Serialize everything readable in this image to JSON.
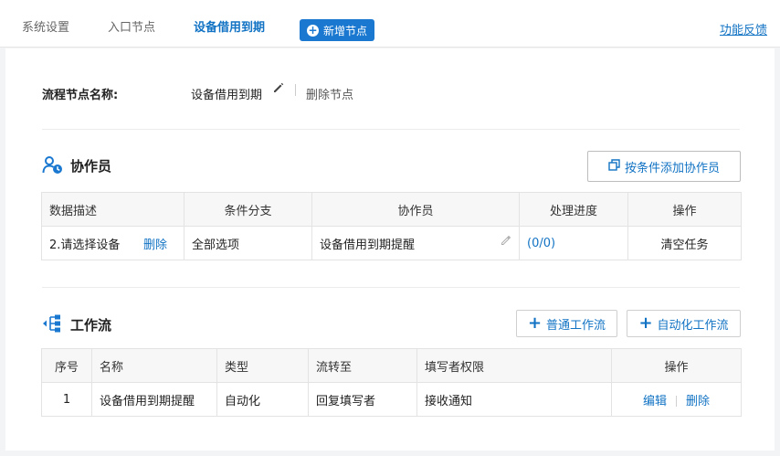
{
  "topbar": {
    "tabs": [
      {
        "label": "系统设置"
      },
      {
        "label": "入口节点"
      },
      {
        "label": "设备借用到期"
      }
    ],
    "add_node_label": "新增节点",
    "feedback_label": "功能反馈"
  },
  "node": {
    "name_label": "流程节点名称:",
    "name_value": "设备借用到期",
    "delete_label": "删除节点"
  },
  "collaborators": {
    "title": "协作员",
    "add_button_label": "按条件添加协作员",
    "columns": [
      "数据描述",
      "条件分支",
      "协作员",
      "处理进度",
      "操作"
    ],
    "rows": [
      {
        "desc": "2.请选择设备",
        "desc_action": "删除",
        "branch": "全部选项",
        "member": "设备借用到期提醒",
        "progress": "(0/0)",
        "action": "清空任务"
      }
    ]
  },
  "workflow": {
    "title": "工作流",
    "normal_button_label": "普通工作流",
    "auto_button_label": "自动化工作流",
    "columns": [
      "序号",
      "名称",
      "类型",
      "流转至",
      "填写者权限",
      "操作"
    ],
    "rows": [
      {
        "index": "1",
        "name": "设备借用到期提醒",
        "type": "自动化",
        "flow_to": "回复填写者",
        "permission": "接收通知",
        "edit": "编辑",
        "delete": "删除"
      }
    ]
  }
}
